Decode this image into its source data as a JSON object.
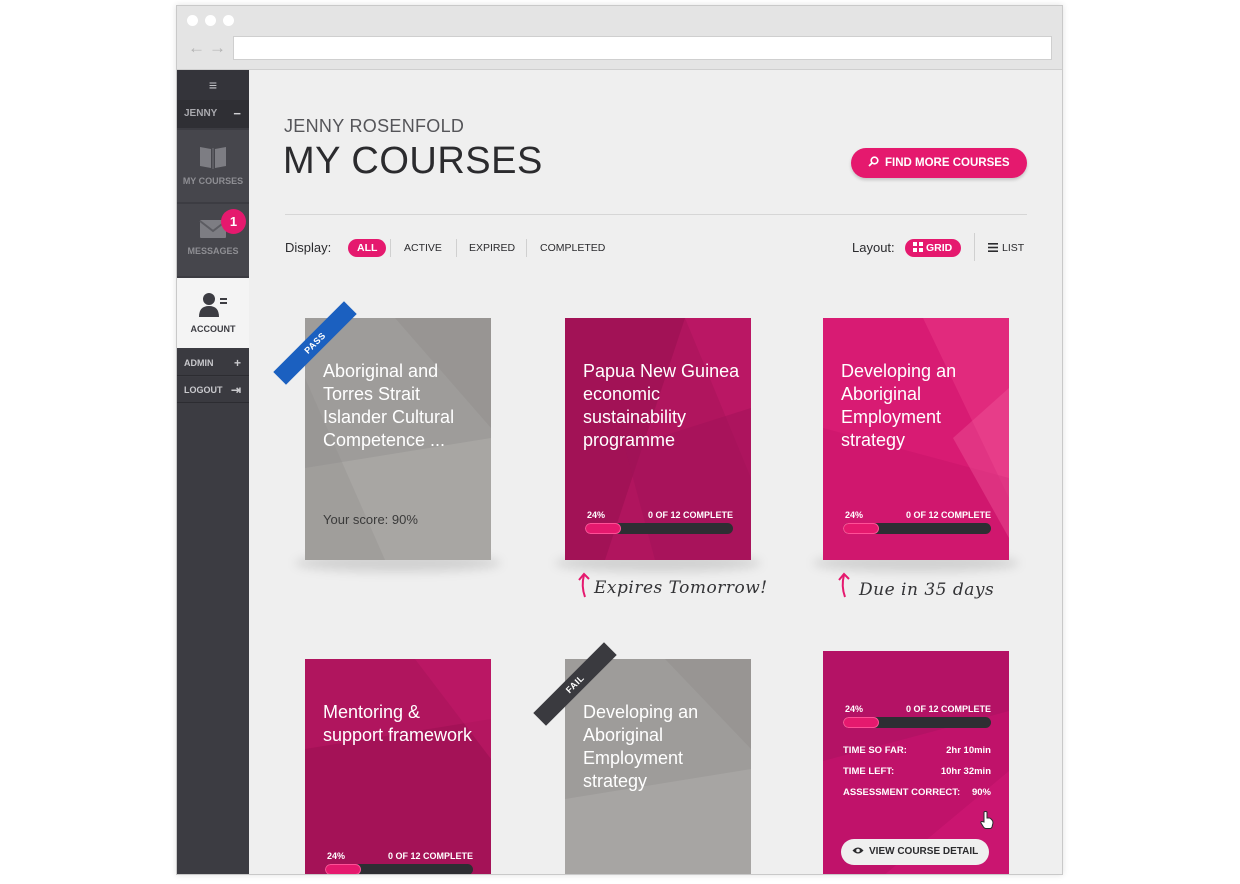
{
  "user": {
    "short_name": "JENNY",
    "full_name": "JENNY ROSENFOLD"
  },
  "sidebar": {
    "menu_glyph": "≡",
    "collapse_glyph": "−",
    "items": [
      {
        "label": "MY COURSES",
        "icon": "book-icon"
      },
      {
        "label": "MESSAGES",
        "icon": "envelope-icon",
        "badge": "1"
      },
      {
        "label": "ACCOUNT",
        "icon": "user-icon",
        "selected": true
      }
    ],
    "rows": [
      {
        "label": "ADMIN",
        "glyph": "+"
      },
      {
        "label": "LOGOUT",
        "glyph": "⇥"
      }
    ]
  },
  "header": {
    "title": "MY COURSES",
    "find_button": "FIND MORE COURSES"
  },
  "filters": {
    "label": "Display:",
    "options": [
      "ALL",
      "ACTIVE",
      "EXPIRED",
      "COMPLETED"
    ],
    "selected": "ALL"
  },
  "layout": {
    "label": "Layout:",
    "options": [
      "GRID",
      "LIST"
    ],
    "selected": "GRID"
  },
  "courses": [
    {
      "title": "Aboriginal and Torres Strait Islander Cultural Competence ...",
      "ribbon": "PASS",
      "score_text": "Your score: 90%",
      "color": "#9e9c9a"
    },
    {
      "title": "Papua New Guinea economic sustainability programme",
      "progress_label": "24%",
      "progress": 0.24,
      "complete_text": "0 OF 12 COMPLETE",
      "note": "Expires Tomorrow!",
      "color": "#b0155e"
    },
    {
      "title": "Developing an Aboriginal Employment strategy",
      "progress_label": "24%",
      "progress": 0.24,
      "complete_text": "0 OF 12 COMPLETE",
      "note": "Due in 35 days",
      "color": "#d81b73"
    },
    {
      "title": "Mentoring & support framework",
      "progress_label": "24%",
      "progress": 0.24,
      "complete_text": "0 OF 12 COMPLETE",
      "color": "#b0155e"
    },
    {
      "title": "Developing an Aboriginal Employment strategy",
      "ribbon": "FAIL",
      "color": "#9e9c9a"
    },
    {
      "progress_label": "24%",
      "progress": 0.24,
      "complete_text": "0 OF 12 COMPLETE",
      "stats": [
        {
          "label": "TIME SO FAR:",
          "value": "2hr 10min"
        },
        {
          "label": "TIME LEFT:",
          "value": "10hr 32min"
        },
        {
          "label": "ASSESSMENT CORRECT:",
          "value": "90%"
        }
      ],
      "detail_button": "VIEW COURSE DETAIL",
      "color": "#c0126a"
    }
  ],
  "colors": {
    "accent": "#e5196e",
    "sidebar": "#3c3c42",
    "pass_ribbon": "#1b60c0",
    "fail_ribbon": "#3a3a3f"
  }
}
